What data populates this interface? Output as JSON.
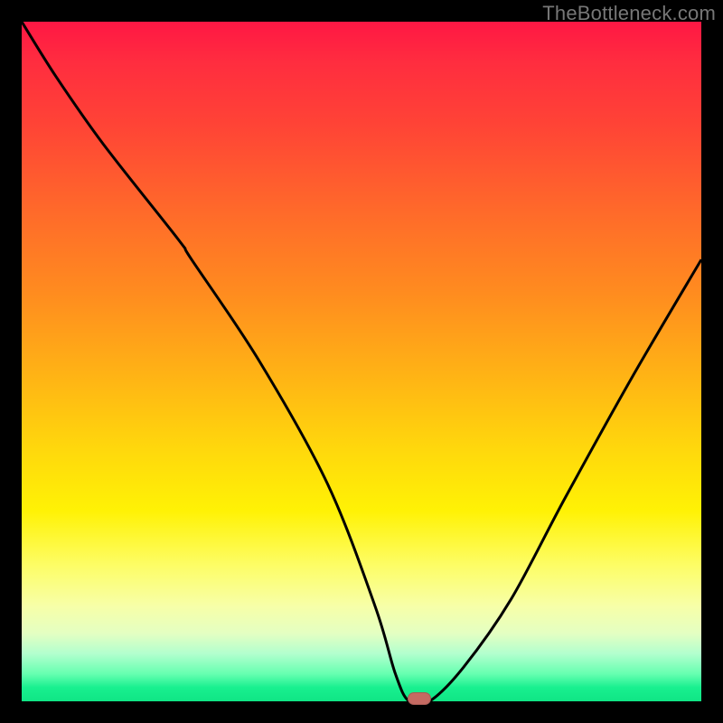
{
  "watermark": "TheBottleneck.com",
  "chart_data": {
    "type": "line",
    "title": "",
    "xlabel": "",
    "ylabel": "",
    "xlim": [
      0,
      100
    ],
    "ylim": [
      0,
      100
    ],
    "grid": false,
    "series": [
      {
        "name": "bottleneck-curve",
        "x": [
          0,
          5,
          12,
          23,
          25,
          35,
          45,
          52,
          55,
          57,
          60,
          65,
          72,
          80,
          90,
          100
        ],
        "values": [
          100,
          92,
          82,
          68,
          65,
          50,
          32,
          14,
          4,
          0,
          0,
          5,
          15,
          30,
          48,
          65
        ]
      }
    ],
    "annotations": [
      {
        "name": "minimum-marker",
        "x": 58.5,
        "y": 0
      }
    ],
    "background_gradient": {
      "top": "#ff1744",
      "mid": "#ffd80c",
      "bottom": "#10e585"
    }
  }
}
